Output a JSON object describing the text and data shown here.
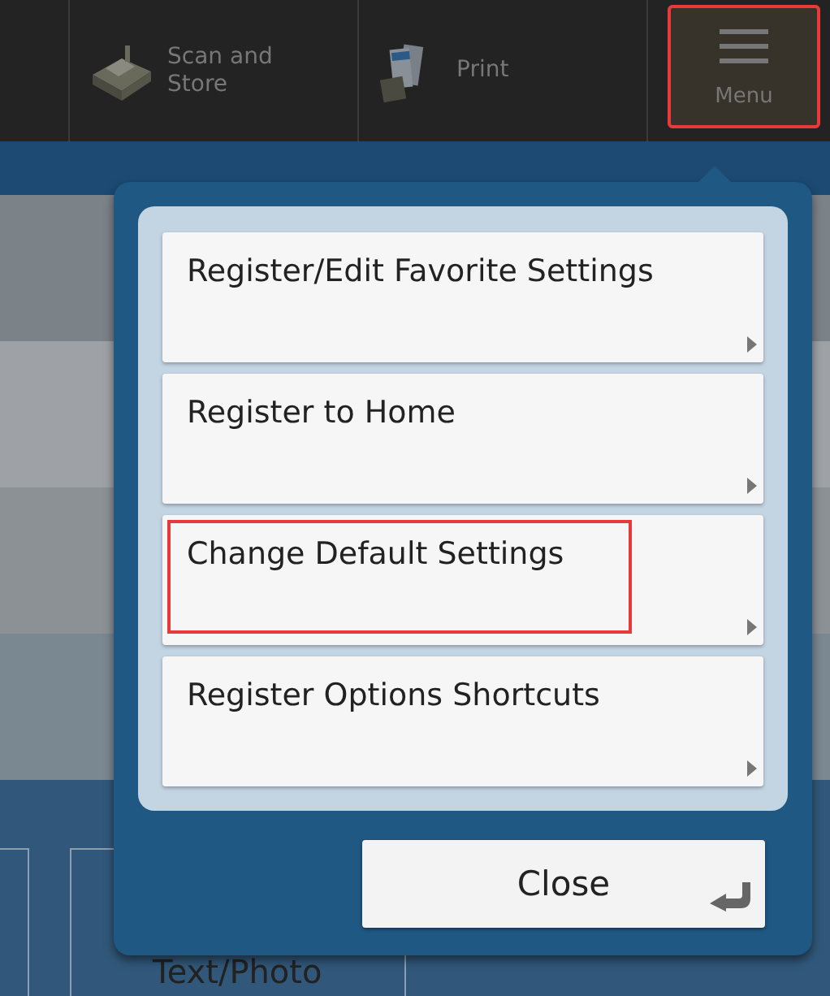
{
  "top_bar": {
    "buttons": [
      {
        "kind": "scan",
        "label": "Scan and\nStore",
        "highlighted": false
      },
      {
        "kind": "print",
        "label": "Print",
        "highlighted": false
      },
      {
        "kind": "menu",
        "label": "Menu",
        "highlighted": true
      }
    ]
  },
  "background": {
    "tile_label": "Text/Photo"
  },
  "menu_popup": {
    "items": [
      {
        "label": "Register/Edit Favorite Settings",
        "highlighted": false
      },
      {
        "label": "Register to Home",
        "highlighted": false
      },
      {
        "label": "Change Default Settings",
        "highlighted": true
      },
      {
        "label": "Register Options Shortcuts",
        "highlighted": false
      }
    ],
    "close_button": "Close"
  }
}
